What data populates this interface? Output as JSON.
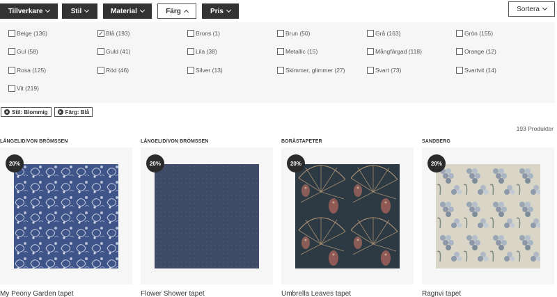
{
  "filters": {
    "tillverkare": "Tillverkare",
    "stil": "Stil",
    "material": "Material",
    "farg": "Färg",
    "pris": "Pris"
  },
  "sort_label": "Sortera",
  "color_options": [
    {
      "label": "Beige (136)",
      "checked": false
    },
    {
      "label": "Blå (193)",
      "checked": true
    },
    {
      "label": "Brons (1)",
      "checked": false
    },
    {
      "label": "Brun (50)",
      "checked": false
    },
    {
      "label": "Grå (163)",
      "checked": false
    },
    {
      "label": "Grön (155)",
      "checked": false
    },
    {
      "label": "Gul (58)",
      "checked": false
    },
    {
      "label": "Guld (41)",
      "checked": false
    },
    {
      "label": "Lila (38)",
      "checked": false
    },
    {
      "label": "Metallic (15)",
      "checked": false
    },
    {
      "label": "Mångfärgad (118)",
      "checked": false
    },
    {
      "label": "Orange (12)",
      "checked": false
    },
    {
      "label": "Rosa (125)",
      "checked": false
    },
    {
      "label": "Röd (46)",
      "checked": false
    },
    {
      "label": "Silver (13)",
      "checked": false
    },
    {
      "label": "Skimmer, glimmer (27)",
      "checked": false
    },
    {
      "label": "Svart (73)",
      "checked": false
    },
    {
      "label": "Svartvit (14)",
      "checked": false
    },
    {
      "label": "Vit (219)",
      "checked": false
    }
  ],
  "active_filters": [
    "Stil: Blommig",
    "Färg: Blå"
  ],
  "product_count": "193 Produkter",
  "products": [
    {
      "brand": "LÅNGELID/VON BRÖMSSEN",
      "name": "My Peony Garden tapet",
      "badge": "20%"
    },
    {
      "brand": "LÅNGELID/VON BRÖMSSEN",
      "name": "Flower Shower tapet",
      "badge": "20%"
    },
    {
      "brand": "BORÅSTAPETER",
      "name": "Umbrella Leaves tapet",
      "badge": "20%"
    },
    {
      "brand": "SANDBERG",
      "name": "Ragnvi tapet",
      "badge": "20%"
    }
  ]
}
